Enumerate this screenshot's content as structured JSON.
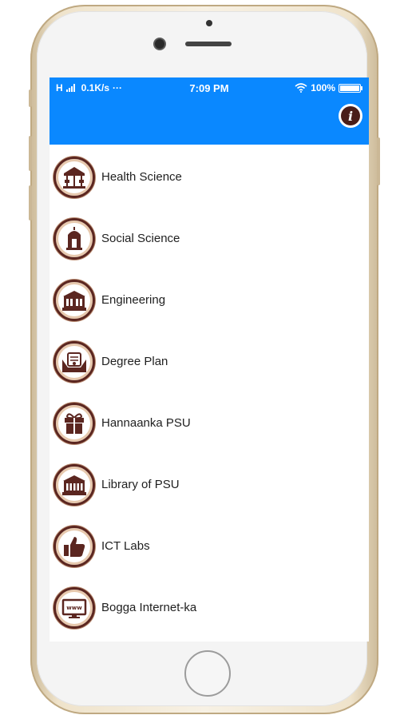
{
  "status": {
    "signal": "H",
    "speed": "0.1K/s",
    "dots": "···",
    "time": "7:09 PM",
    "battery": "100%"
  },
  "appbar": {
    "info_icon": "info-icon"
  },
  "menu": [
    {
      "label": "Health Science",
      "icon": "carousel-icon"
    },
    {
      "label": "Social Science",
      "icon": "shrine-icon"
    },
    {
      "label": "Engineering",
      "icon": "building-icon"
    },
    {
      "label": "Degree Plan",
      "icon": "diploma-icon"
    },
    {
      "label": "Hannaanka PSU",
      "icon": "gift-icon"
    },
    {
      "label": "Library of PSU",
      "icon": "library-icon"
    },
    {
      "label": "ICT Labs",
      "icon": "thumbs-up-icon"
    },
    {
      "label": "Bogga Internet-ka",
      "icon": "www-monitor-icon"
    }
  ],
  "colors": {
    "primary": "#0a88ff",
    "emblem": "#5b2620"
  }
}
